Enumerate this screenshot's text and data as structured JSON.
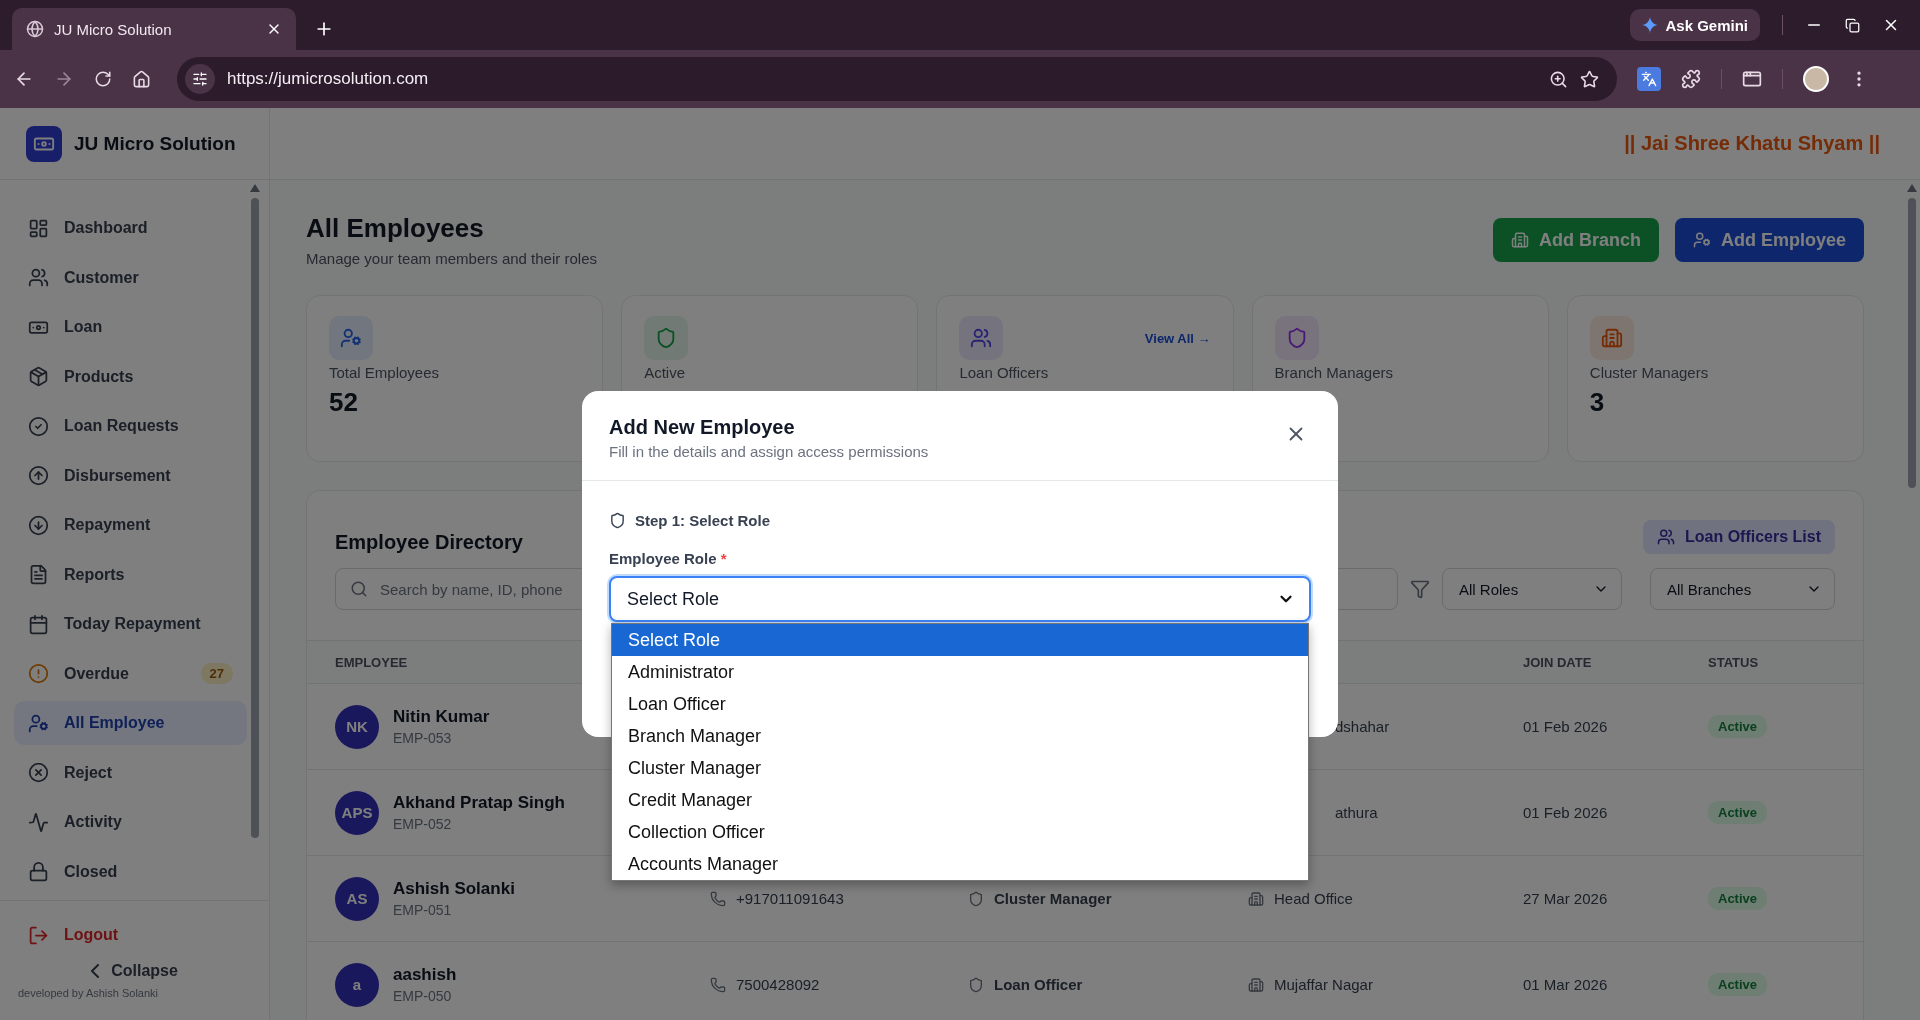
{
  "browser": {
    "tab_title": "JU Micro Solution",
    "url": "https://jumicrosolution.com",
    "gemini_button": "Ask Gemini"
  },
  "sidebar": {
    "brand": "JU Micro Solution",
    "items": [
      {
        "label": "Dashboard",
        "selected": false
      },
      {
        "label": "Customer",
        "selected": false
      },
      {
        "label": "Loan",
        "selected": false
      },
      {
        "label": "Products",
        "selected": false
      },
      {
        "label": "Loan Requests",
        "selected": false
      },
      {
        "label": "Disbursement",
        "selected": false
      },
      {
        "label": "Repayment",
        "selected": false
      },
      {
        "label": "Reports",
        "selected": false
      },
      {
        "label": "Today Repayment",
        "selected": false
      },
      {
        "label": "Overdue",
        "selected": false,
        "badge": "27"
      },
      {
        "label": "All Employee",
        "selected": true
      },
      {
        "label": "Reject",
        "selected": false
      },
      {
        "label": "Activity",
        "selected": false
      },
      {
        "label": "Closed",
        "selected": false
      }
    ],
    "logout": "Logout",
    "collapse": "Collapse",
    "credit": "developed by Ashish Solanki"
  },
  "header": {
    "motto": "|| Jai Shree Khatu Shyam ||"
  },
  "page": {
    "title": "All Employees",
    "subtitle": "Manage your team members and their roles",
    "buttons": [
      {
        "label": "Add Branch",
        "kind": "branch"
      },
      {
        "label": "Add Employee",
        "kind": "employee"
      }
    ]
  },
  "stats": [
    {
      "label": "Total Employees",
      "value": "52"
    },
    {
      "label": "Active"
    },
    {
      "label": "Loan Officers",
      "link": "View All →"
    },
    {
      "label": "Branch Managers"
    },
    {
      "label": "Cluster Managers",
      "value": "3"
    }
  ],
  "directory": {
    "title": "Employee Directory",
    "loan_officers_button": "Loan Officers List",
    "search": {
      "placeholder": "Search by name, ID, phone"
    },
    "role_filter": "All Roles",
    "branch_filter": "All Branches",
    "columns": {
      "employee": "EMPLOYEE",
      "join_date": "JOIN DATE",
      "status": "STATUS"
    },
    "rows": [
      {
        "initials": "NK",
        "name": "Nitin Kumar",
        "id": "EMP-053",
        "branch": "dshahar",
        "join_date": "01 Feb 2026",
        "status": "Active"
      },
      {
        "initials": "APS",
        "name": "Akhand Pratap Singh",
        "id": "EMP-052",
        "branch": "athura",
        "join_date": "01 Feb 2026",
        "status": "Active"
      },
      {
        "initials": "AS",
        "name": "Ashish Solanki",
        "id": "EMP-051",
        "phone": "+917011091643",
        "role": "Cluster Manager",
        "branch": "Head Office",
        "join_date": "27 Mar 2026",
        "status": "Active"
      },
      {
        "initials": "a",
        "name": "aashish",
        "id": "EMP-050",
        "phone": "7500428092",
        "role": "Loan Officer",
        "branch": "Mujaffar Nagar",
        "join_date": "01 Mar 2026",
        "status": "Active"
      }
    ]
  },
  "modal": {
    "title": "Add New Employee",
    "subtitle": "Fill in the details and assign access permissions",
    "step": "Step 1: Select Role",
    "role_field": {
      "label": "Employee Role",
      "required_mark": "*",
      "value": "Select Role",
      "expanded": true
    },
    "role_options": [
      {
        "label": "Select Role",
        "selected": true
      },
      {
        "label": "Administrator",
        "selected": false
      },
      {
        "label": "Loan Officer",
        "selected": false
      },
      {
        "label": "Branch Manager",
        "selected": false
      },
      {
        "label": "Cluster Manager",
        "selected": false
      },
      {
        "label": "Credit Manager",
        "selected": false
      },
      {
        "label": "Collection Officer",
        "selected": false
      },
      {
        "label": "Accounts Manager",
        "selected": false
      }
    ]
  }
}
